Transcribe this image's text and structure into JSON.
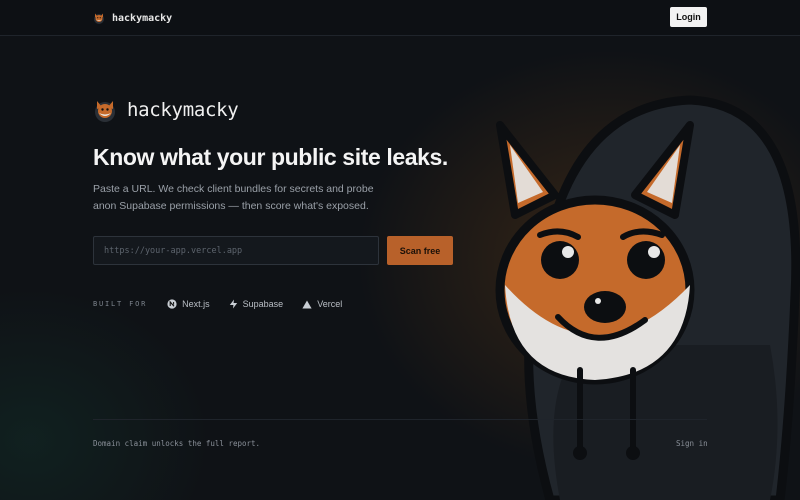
{
  "navbar": {
    "brand": "hackymacky",
    "login_label": "Login"
  },
  "hero": {
    "brand": "hackymacky",
    "headline": "Know what your public site leaks.",
    "subtext": "Paste a URL. We check client bundles for secrets and probe anon Supabase permissions — then score what's exposed."
  },
  "scan": {
    "placeholder": "https://your-app.vercel.app",
    "button_label": "Scan free"
  },
  "built_with": {
    "label": "BUILT FOR",
    "items": [
      {
        "name": "Next.js",
        "icon": "nextjs-icon"
      },
      {
        "name": "Supabase",
        "icon": "supabase-icon"
      },
      {
        "name": "Vercel",
        "icon": "vercel-icon"
      }
    ]
  },
  "footer": {
    "note": "Domain claim unlocks the full report.",
    "signin_label": "Sign in"
  },
  "colors": {
    "background": "#0f1216",
    "accent": "#b8612a",
    "fox_orange": "#c56a2b"
  }
}
